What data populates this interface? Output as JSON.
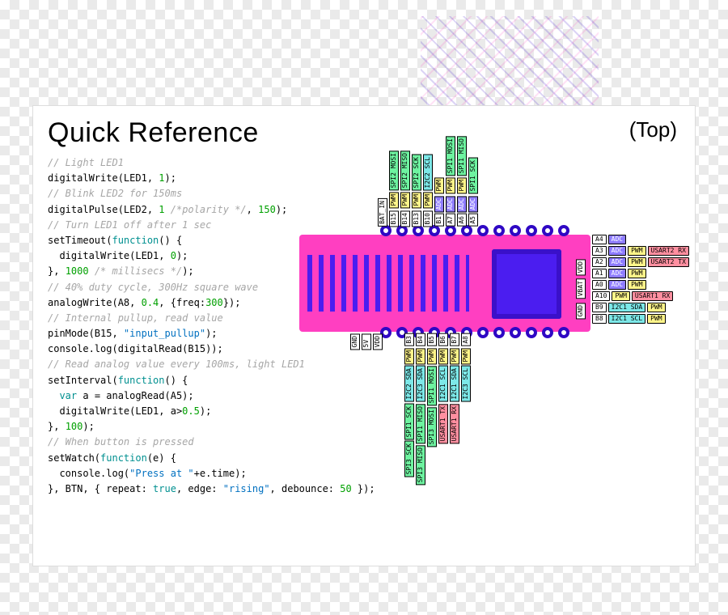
{
  "title": "Quick Reference",
  "top_label": "(Top)",
  "code": {
    "c1": "// Light LED1",
    "l1a": "digitalWrite(LED1, ",
    "l1b": "1",
    "l1c": ");",
    "c2": "// Blink LED2 for 150ms",
    "l2a": "digitalPulse(LED2, ",
    "l2b": "1",
    "l2c": " /*polarity */",
    "l2d": ", ",
    "l2e": "150",
    "l2f": ");",
    "c3": "// Turn LED1 off after 1 sec",
    "l3a": "setTimeout(",
    "l3b": "function",
    "l3c": "() {",
    "l4a": "  digitalWrite(LED1, ",
    "l4b": "0",
    "l4c": ");",
    "l5a": "}, ",
    "l5b": "1000",
    "l5c": " /* millisecs */",
    "l5d": ");",
    "c4": "// 40% duty cycle, 300Hz square wave",
    "l6a": "analogWrite(A8, ",
    "l6b": "0.4",
    "l6c": ", {freq:",
    "l6d": "300",
    "l6e": "});",
    "c5": "// Internal pullup, read value",
    "l7a": "pinMode(B15, ",
    "l7b": "\"input_pullup\"",
    "l7c": ");",
    "l8": "console.log(digitalRead(B15));",
    "c6": "// Read analog value every 100ms, light LED1",
    "l9a": "setInterval(",
    "l9b": "function",
    "l9c": "() {",
    "l10a": "  ",
    "l10b": "var",
    "l10c": " a = analogRead(A5);",
    "l11a": "  digitalWrite(LED1, a>",
    "l11b": "0.5",
    "l11c": ");",
    "l12a": "}, ",
    "l12b": "100",
    "l12c": ");",
    "c7": "// When button is pressed",
    "l13a": "setWatch(",
    "l13b": "function",
    "l13c": "(e) {",
    "l14a": "  console.log(",
    "l14b": "\"Press at \"",
    "l14c": "+e.time);",
    "l15a": "}, BTN, { repeat: ",
    "l15b": "true",
    "l15c": ", edge: ",
    "l15d": "\"rising\"",
    "l15e": ", debounce: ",
    "l15f": "50",
    "l15g": " });"
  },
  "top_pins": [
    {
      "pin": "BAT_IN",
      "tags": []
    },
    {
      "pin": "B15",
      "tags": [
        "PWM",
        "SPI2 MOSI"
      ]
    },
    {
      "pin": "B14",
      "tags": [
        "PWM",
        "SPI2 MISO"
      ]
    },
    {
      "pin": "B13",
      "tags": [
        "PWM",
        "SPI2 SCK"
      ]
    },
    {
      "pin": "B10",
      "tags": [
        "PWM",
        "I2C2 SCL"
      ]
    },
    {
      "pin": "B1",
      "tags": [
        "ADC",
        "PWM"
      ]
    },
    {
      "pin": "A7",
      "tags": [
        "ADC",
        "PWM",
        "SPI1 MOSI"
      ]
    },
    {
      "pin": "A6",
      "tags": [
        "ADC",
        "PWM",
        "SPI1 MISO"
      ]
    },
    {
      "pin": "A5",
      "tags": [
        "ADC",
        "SPI1 SCK"
      ]
    }
  ],
  "right_rows": [
    {
      "pin": "A4",
      "tags": [
        "ADC"
      ]
    },
    {
      "pin": "A3",
      "tags": [
        "ADC",
        "PWM",
        "USART2 RX"
      ]
    },
    {
      "pin": "A2",
      "tags": [
        "ADC",
        "PWM",
        "USART2 TX"
      ]
    },
    {
      "pin": "A1",
      "tags": [
        "ADC",
        "PWM"
      ]
    },
    {
      "pin": "A0",
      "tags": [
        "ADC",
        "PWM"
      ]
    },
    {
      "pin": "A10",
      "tags": [
        "PWM",
        "USART1 RX"
      ]
    },
    {
      "pin": "B9",
      "tags": [
        "I2C1 SDA",
        "PWM"
      ]
    },
    {
      "pin": "B8",
      "tags": [
        "I2C1 SCL",
        "PWM"
      ]
    }
  ],
  "bottom_pins_left": [
    "GND",
    "5V",
    "VDD"
  ],
  "bottom_pins": [
    {
      "pin": "B3",
      "tags": [
        "PWM",
        "I2C2 SDA",
        "SPI1 SCK",
        "SPI3 SCK"
      ]
    },
    {
      "pin": "B4",
      "tags": [
        "PWM",
        "I2C3 SDA",
        "SPI1 MISO",
        "SPI3 MISO"
      ]
    },
    {
      "pin": "B5",
      "tags": [
        "PWM",
        "SPI1 MOSI",
        "SPI3 MOSI"
      ]
    },
    {
      "pin": "B6",
      "tags": [
        "PWM",
        "I2C1 SCL",
        "USART1 TX"
      ]
    },
    {
      "pin": "B7",
      "tags": [
        "PWM",
        "I2C1 SDA",
        "USART1 RX"
      ]
    },
    {
      "pin": "A8",
      "tags": [
        "PWM",
        "I2C3 SCL"
      ]
    }
  ],
  "board_labels": {
    "vdd": "VDD",
    "vbat": "VBAT",
    "gnd": "GND"
  },
  "colors": {
    "pwm": "#fff58a",
    "adc": "#8e7cff",
    "spi": "#6ef3a0",
    "i2c": "#7de8e8",
    "usart": "#ff8fa0",
    "pcb": "#ff3fc1",
    "chip": "#4b1df0"
  }
}
